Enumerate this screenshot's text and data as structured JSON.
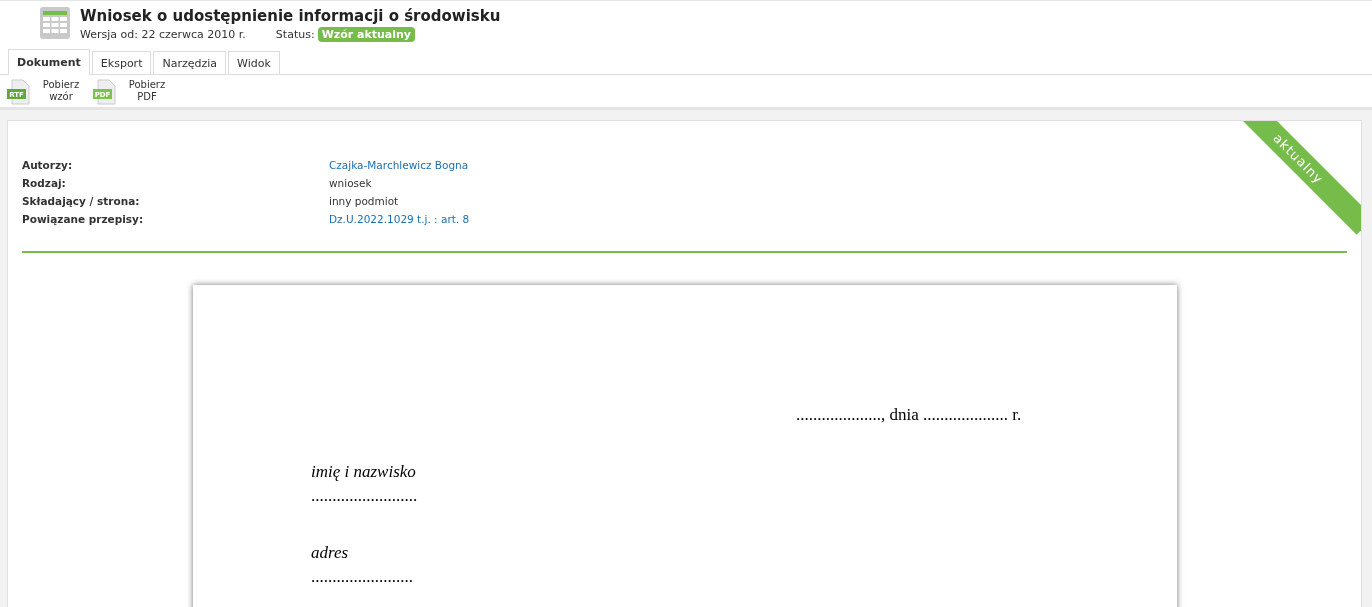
{
  "header": {
    "title": "Wniosek o udostępnienie informacji o środowisku",
    "version": "Wersja od: 22 czerwca 2010 r.",
    "status_label": "Status:",
    "status_badge": "Wzór aktualny"
  },
  "tabs": [
    {
      "label": "Dokument",
      "selected": true
    },
    {
      "label": "Eksport",
      "selected": false
    },
    {
      "label": "Narzędzia",
      "selected": false
    },
    {
      "label": "Widok",
      "selected": false
    }
  ],
  "toolbar": [
    {
      "kind": "rtf",
      "icon_text": "RTF",
      "label": "Pobierz wzór"
    },
    {
      "kind": "pdf",
      "icon_text": "PDF",
      "label": "Pobierz PDF"
    }
  ],
  "ribbon": "aktualny",
  "details": [
    {
      "label": "Autorzy:",
      "value": "Czajka-Marchlewicz Bogna",
      "kind": "link"
    },
    {
      "label": "Rodzaj:",
      "value": "wniosek",
      "kind": "text"
    },
    {
      "label": "Składający / strona:",
      "value": "inny podmiot",
      "kind": "text"
    },
    {
      "label": "Powiązane przepisy:",
      "value": "Dz.U.2022.1029 t.j. : art. 8",
      "kind": "link"
    }
  ],
  "document": [
    {
      "kind": "date",
      "text": "...................., dnia .................... r."
    },
    {
      "kind": "label",
      "text": "imię i nazwisko"
    },
    {
      "kind": "fill",
      "text": "........................."
    },
    {
      "kind": "label",
      "text": "adres"
    },
    {
      "kind": "fill",
      "text": "........................"
    }
  ]
}
